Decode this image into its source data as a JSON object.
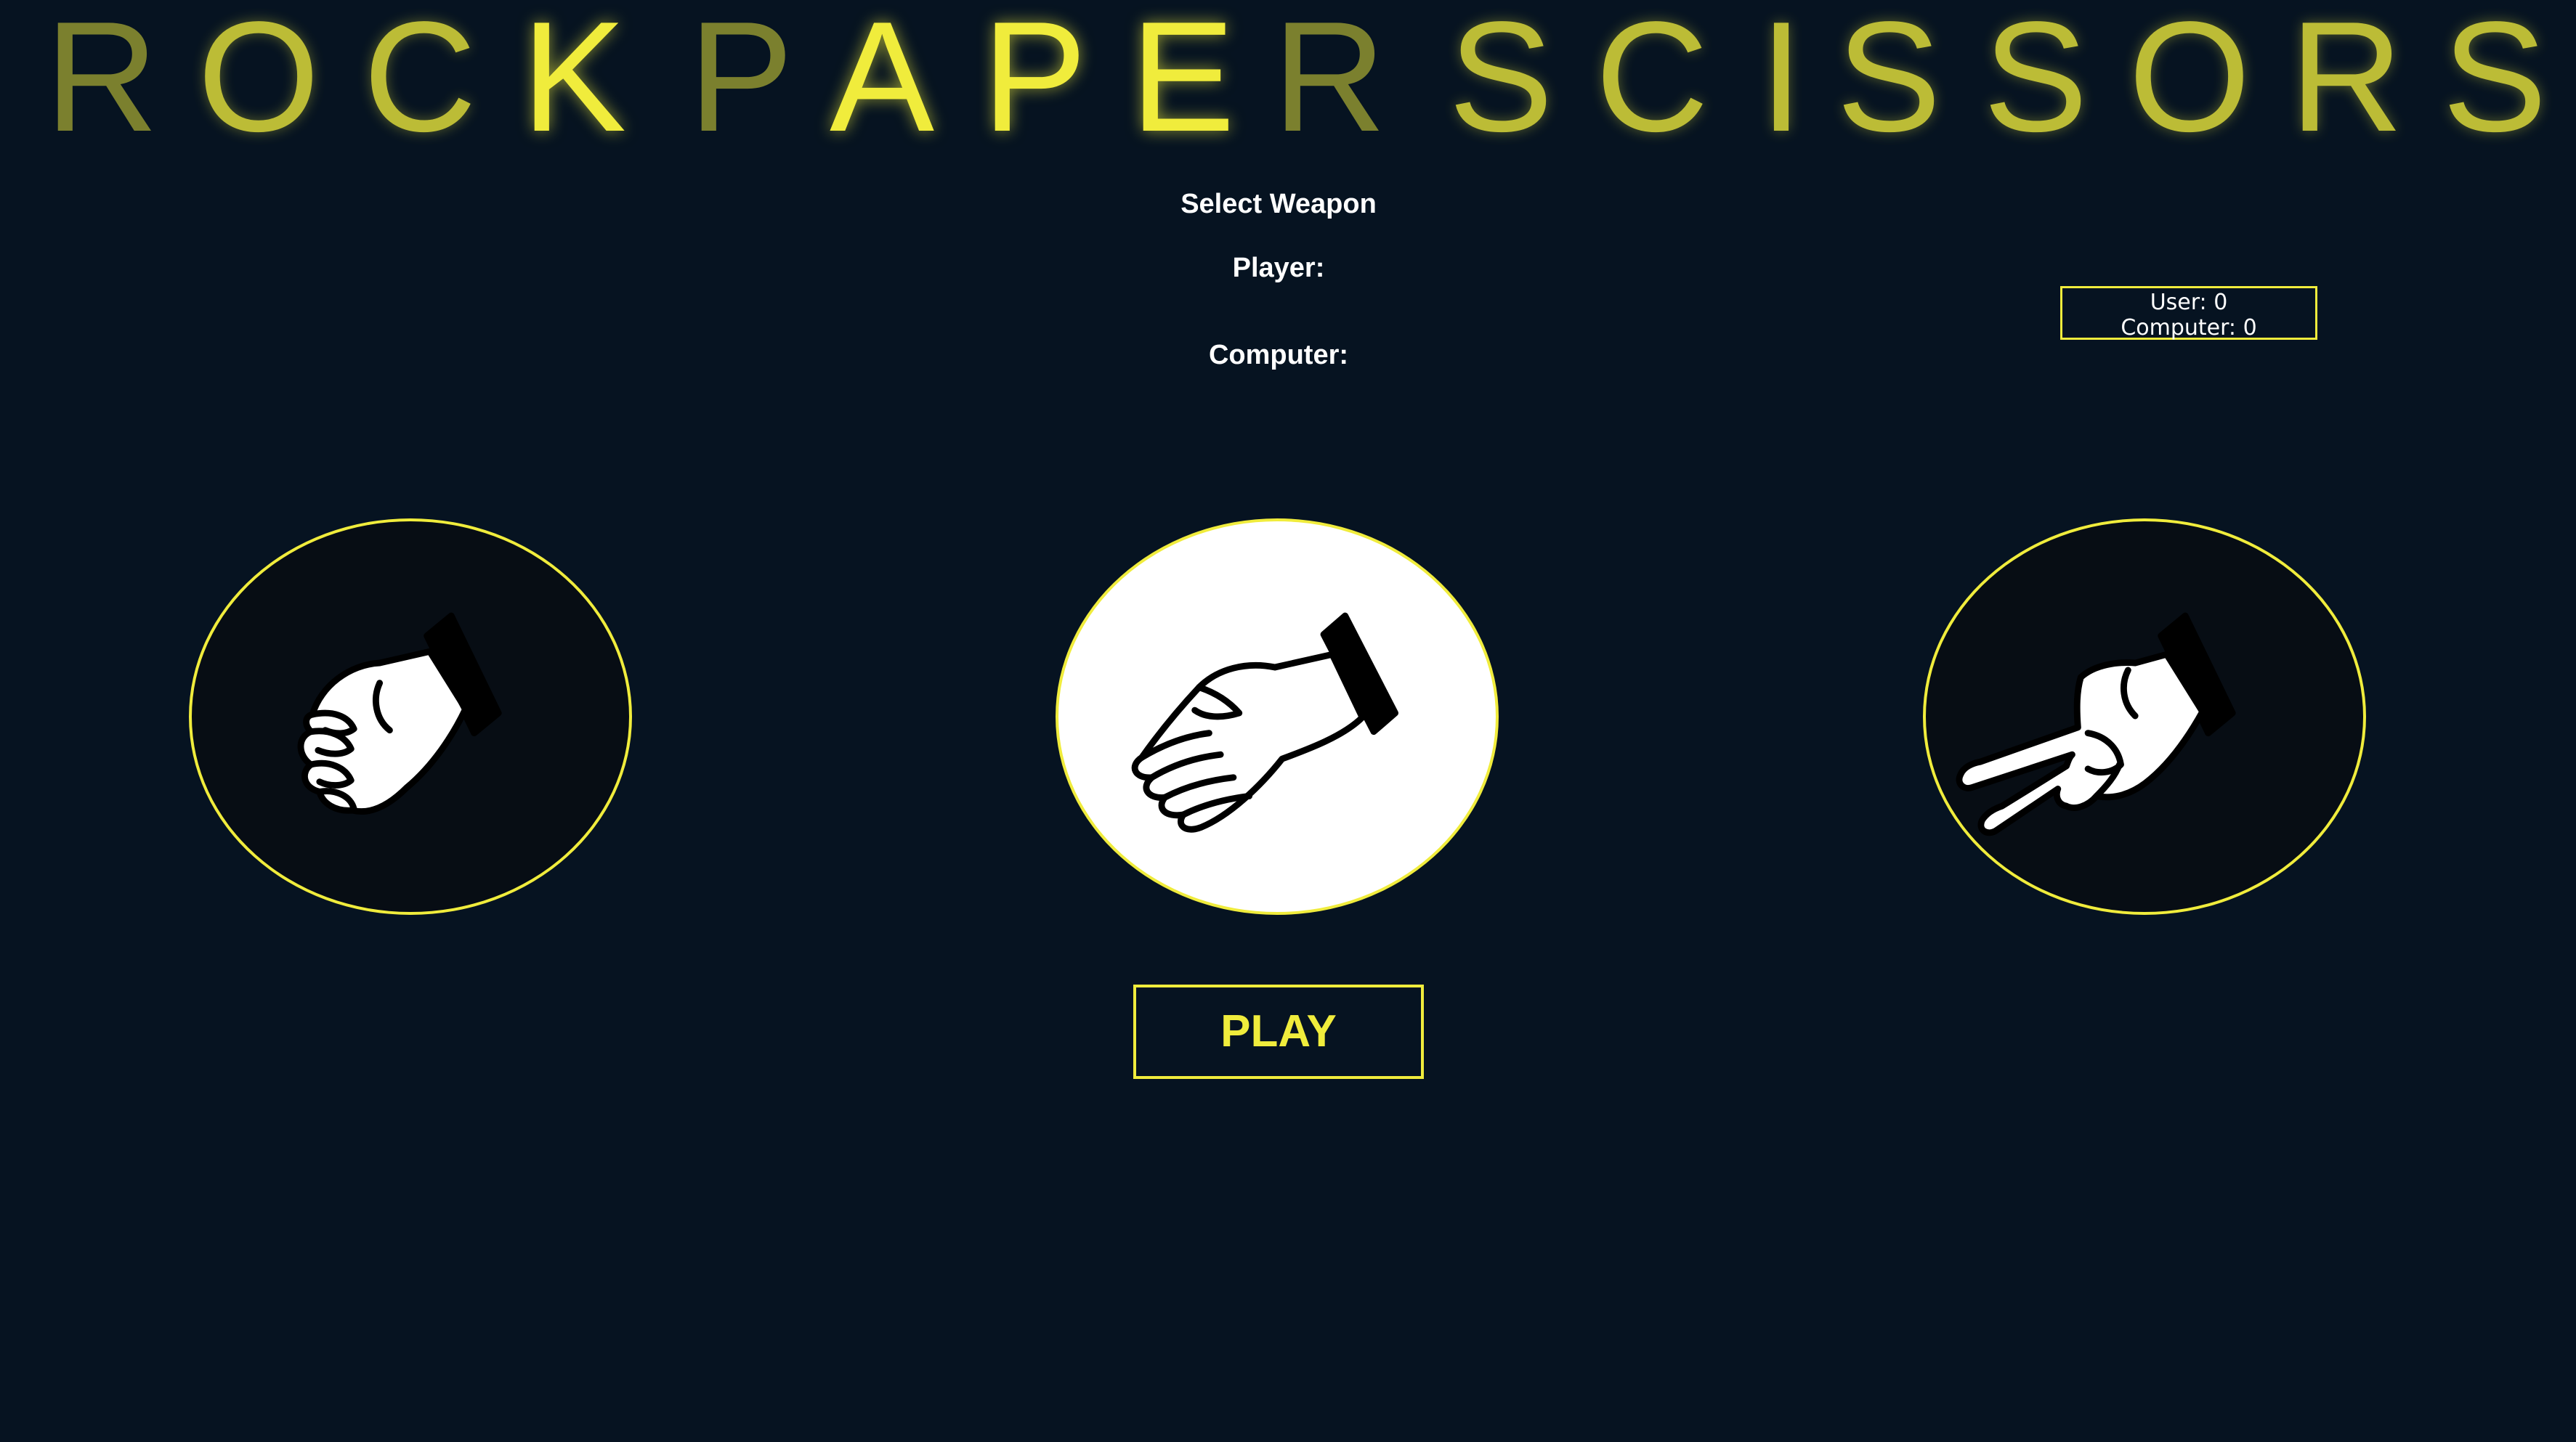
{
  "title": {
    "letters": [
      "R",
      "O",
      "C",
      "K",
      "P",
      "A",
      "P",
      "E",
      "R",
      "S",
      "C",
      "I",
      "S",
      "S",
      "O",
      "R",
      "S"
    ]
  },
  "game": {
    "select_label": "Select Weapon",
    "player_label": "Player:",
    "computer_label": "Computer:"
  },
  "scoreboard": {
    "user_line": "User: 0",
    "computer_line": "Computer: 0"
  },
  "weapons": [
    {
      "name": "rock",
      "icon": "fist-hand-icon",
      "selected": false
    },
    {
      "name": "paper",
      "icon": "open-hand-icon",
      "selected": true
    },
    {
      "name": "scissors",
      "icon": "two-finger-hand-icon",
      "selected": false
    }
  ],
  "play_button": {
    "label": "PLAY"
  },
  "colors": {
    "background": "#061321",
    "accent": "#f0ec3c",
    "text": "#ffffff",
    "circle_fill": "#070d14",
    "selected_fill": "#ffffff"
  }
}
